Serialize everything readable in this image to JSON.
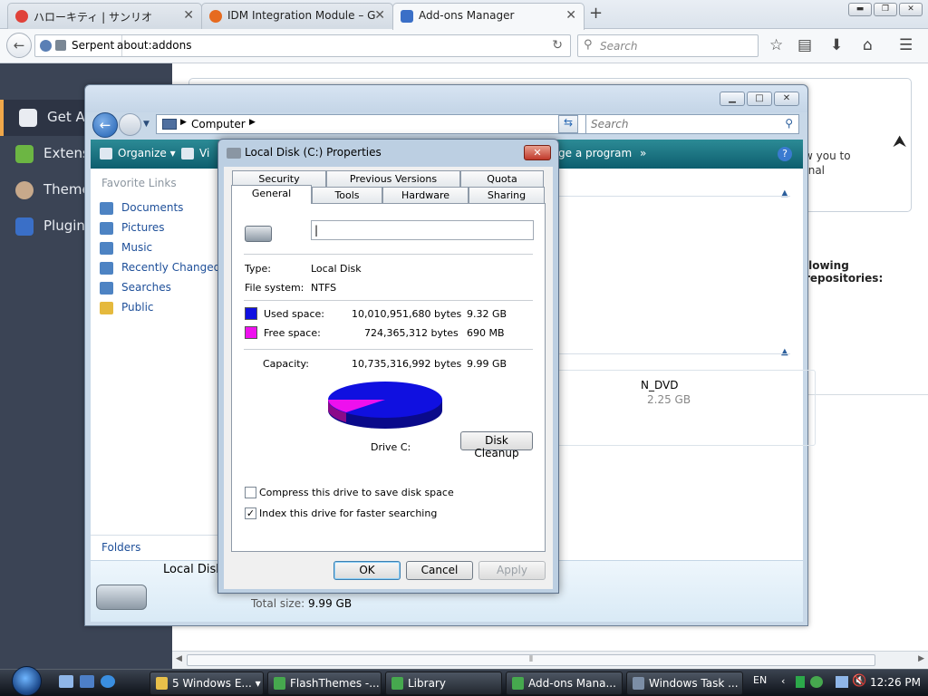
{
  "firefox": {
    "tabs": [
      {
        "title": "ハローキティ | サンリオ",
        "icon_color": "#e0423a"
      },
      {
        "title": "IDM Integration Module – G",
        "icon_color": "#e66a1f"
      },
      {
        "title": "Add-ons Manager",
        "icon_color": "#3a6fc7",
        "active": true
      }
    ],
    "new_tab": "+",
    "identity": "Serpent",
    "url": "about:addons",
    "search_placeholder": "Search",
    "window_buttons": {
      "minimize": "▬",
      "restore": "❐",
      "close": "✕"
    }
  },
  "addons": {
    "sidebar": [
      {
        "label": "Get Add-ons",
        "icon_color": "#e9ecf1",
        "selected": true
      },
      {
        "label": "Extensions",
        "icon_color": "#6cb643"
      },
      {
        "label": "Themes",
        "icon_color": "#c7a98b"
      },
      {
        "label": "Plugins",
        "icon_color": "#3a6fc7"
      }
    ],
    "card_text_1": "w you to",
    "card_text_2": "rnal",
    "repos_text": "llowing repositories:",
    "dvd_name": "N_DVD",
    "dvd_size": "2.25 GB"
  },
  "explorer": {
    "address": "Computer",
    "search_placeholder": "Search",
    "toolbar": {
      "organize": "Organize",
      "views": "Vi",
      "uninstall": "ge a program",
      "more": "»",
      "help": "?"
    },
    "favorites_header": "Favorite Links",
    "favorites": [
      {
        "label": "Documents",
        "icon_color": "#4d83c3"
      },
      {
        "label": "Pictures",
        "icon_color": "#4d83c3"
      },
      {
        "label": "Music",
        "icon_color": "#4d83c3"
      },
      {
        "label": "Recently Changed",
        "icon_color": "#4d83c3"
      },
      {
        "label": "Searches",
        "icon_color": "#4d83c3"
      },
      {
        "label": "Public",
        "icon_color": "#e5b93d"
      }
    ],
    "folders": "Folders",
    "details_name": "Local Disk",
    "total_size_label": "Total size:",
    "total_size_value": "9.99 GB"
  },
  "dialog": {
    "title": "Local Disk (C:) Properties",
    "tabs_row1": [
      "Security",
      "Previous Versions",
      "Quota"
    ],
    "tabs_row2": [
      "General",
      "Tools",
      "Hardware",
      "Sharing"
    ],
    "name_value": "",
    "type_label": "Type:",
    "type_value": "Local Disk",
    "fs_label": "File system:",
    "fs_value": "NTFS",
    "used_label": "Used space:",
    "used_bytes": "10,010,951,680 bytes",
    "used_gb": "9.32 GB",
    "used_color": "#1010e0",
    "free_label": "Free space:",
    "free_bytes": "724,365,312 bytes",
    "free_gb": "690 MB",
    "free_color": "#ee10ee",
    "capacity_label": "Capacity:",
    "capacity_bytes": "10,735,316,992 bytes",
    "capacity_gb": "9.99 GB",
    "drive_label": "Drive C:",
    "cleanup": "Disk Cleanup",
    "compress": "Compress this drive to save disk space",
    "compress_checked": false,
    "index": "Index this drive for faster searching",
    "index_checked": true,
    "ok": "OK",
    "cancel": "Cancel",
    "apply": "Apply"
  },
  "taskbar": {
    "buttons": [
      {
        "label": "5 Windows E...",
        "icon_color": "#e8c04a"
      },
      {
        "label": "FlashThemes -...",
        "icon_color": "#46a84e"
      },
      {
        "label": "Library",
        "icon_color": "#46a84e"
      },
      {
        "label": "Add-ons Mana...",
        "icon_color": "#46a84e"
      },
      {
        "label": "Windows Task ...",
        "icon_color": "#7c8ea6"
      }
    ],
    "lang": "EN",
    "clock": "12:26 PM"
  }
}
